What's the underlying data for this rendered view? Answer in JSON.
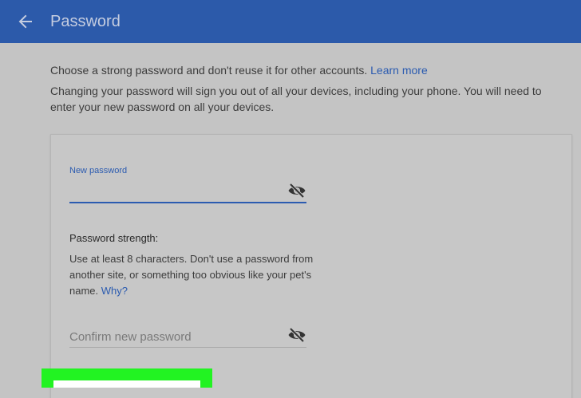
{
  "header": {
    "title": "Password",
    "back_icon": "arrow-left-icon"
  },
  "intro": {
    "line1_text": "Choose a strong password and don't reuse it for other accounts.",
    "line1_link": "Learn more",
    "line2_text": "Changing your password will sign you out of all your devices, including your phone. You will need to enter your new password on all your devices."
  },
  "new_password": {
    "label": "New password",
    "value": "",
    "toggle_icon": "eye-off-icon"
  },
  "strength": {
    "title": "Password strength:",
    "text": "Use at least 8 characters. Don't use a password from another site, or something too obvious like your pet's name.",
    "link": "Why?"
  },
  "confirm_password": {
    "placeholder": "Confirm new password",
    "value": "",
    "toggle_icon": "eye-off-icon"
  },
  "colors": {
    "header_bg": "#2c5aaa",
    "link": "#2b5bb0",
    "highlight": "#22f322"
  }
}
